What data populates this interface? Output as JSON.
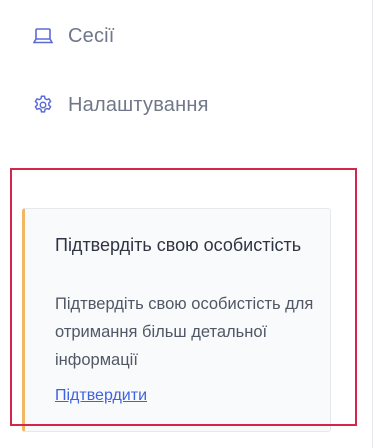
{
  "nav": {
    "items": [
      {
        "label": "Сесії",
        "icon": "laptop-icon"
      },
      {
        "label": "Налаштування",
        "icon": "gear-icon"
      }
    ]
  },
  "verify_card": {
    "title": "Підтвердіть свою особистість",
    "description": "Підтвердіть свою особистість для отримання більш детальної інформації",
    "link_label": "Підтвердити"
  },
  "colors": {
    "nav_icon": "#5b6bd6",
    "nav_text": "#6f7788",
    "highlight_border": "#d3264b",
    "card_accent": "#f1b765",
    "link": "#3f63e0"
  }
}
